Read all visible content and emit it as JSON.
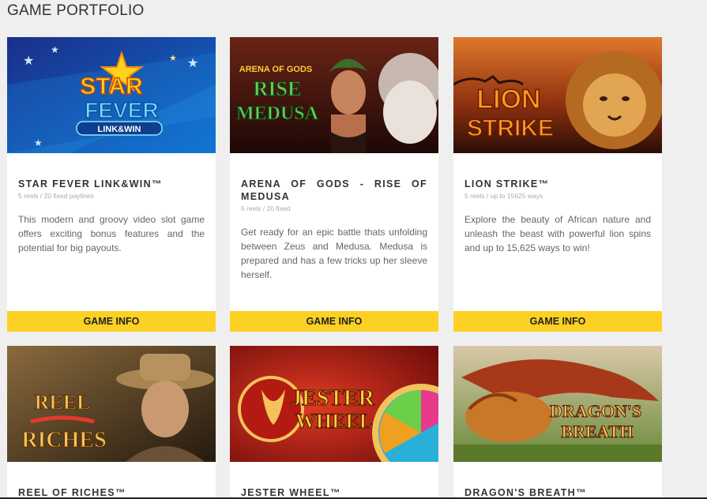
{
  "page": {
    "title": "GAME PORTFOLIO"
  },
  "games": [
    {
      "title": "STAR FEVER LINK&WIN™",
      "specs": "5 reels / 20 fixed paylines",
      "description": "This modern and groovy video slot game offers exciting bonus features and the potential for big payouts.",
      "button": "GAME INFO",
      "art": {
        "line1": "STAR",
        "line2": "FEVER",
        "line3": "LINK&WIN",
        "colors": [
          "#1a3a9c",
          "#0f7fd6"
        ]
      }
    },
    {
      "title": "ARENA OF GODS - RISE OF MEDUSA",
      "specs": "5 reels / 20 fixed",
      "description": "Get ready for an epic battle thats unfolding between Zeus and Medusa. Medusa is prepared and has a few tricks up her sleeve herself.",
      "button": "GAME INFO",
      "art": {
        "line1": "ARENA OF GODS",
        "line2": "RISE",
        "line3": "MEDUSA",
        "colors": [
          "#5a1a12",
          "#2a0a08"
        ]
      }
    },
    {
      "title": "LION STRIKE™",
      "specs": "5 reels / up to 15625 ways",
      "description": "Explore the beauty of African nature and unleash the beast with powerful lion spins and up to 15,625 ways to win!",
      "button": "GAME INFO",
      "art": {
        "line1": "LION",
        "line2": "STRIKE",
        "colors": [
          "#b8431a",
          "#3a1a0a"
        ]
      }
    },
    {
      "title": "REEL OF RICHES™",
      "art": {
        "line1": "REEL",
        "line2": "RICHES",
        "colors": [
          "#7a5a30",
          "#2a1e10"
        ]
      }
    },
    {
      "title": "JESTER WHEEL™",
      "art": {
        "line1": "JESTER",
        "line2": "WHEEL",
        "colors": [
          "#c0281a",
          "#6a0a0a"
        ]
      }
    },
    {
      "title": "DRAGON'S BREATH™",
      "art": {
        "line1": "DRAGON'S",
        "line2": "BREATH",
        "colors": [
          "#c98a3a",
          "#7a3a10"
        ]
      }
    }
  ]
}
